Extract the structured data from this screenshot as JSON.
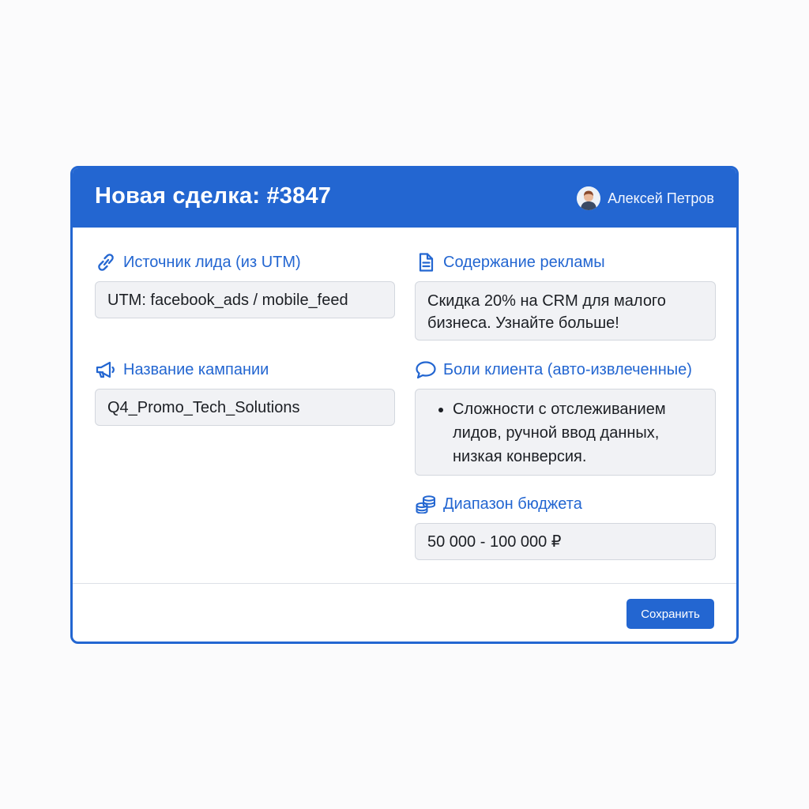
{
  "modal": {
    "title": "Новая сделка: #3847",
    "user_name": "Алексей Петров",
    "save_label": "Сохранить"
  },
  "fields": {
    "lead_source": {
      "label": "Источник лида (из UTM)",
      "value": "UTM: facebook_ads / mobile_feed",
      "icon": "link-icon"
    },
    "campaign_name": {
      "label": "Название кампании",
      "value": "Q4_Promo_Tech_Solutions",
      "icon": "megaphone-icon"
    },
    "ad_content": {
      "label": "Содержание рекламы",
      "value": "Скидка 20% на CRM для малого бизнеса. Узнайте больше!",
      "icon": "document-icon"
    },
    "pain_points": {
      "label": "Боли клиента (авто-извлеченные)",
      "items": [
        "Сложности с отслеживанием лидов, ручной ввод данных, низкая конверсия."
      ],
      "icon": "chat-bubble-icon"
    },
    "budget_range": {
      "label": "Диапазон бюджета",
      "value": "50 000 - 100 000 ₽",
      "icon": "coins-icon"
    }
  },
  "colors": {
    "accent": "#2366d1",
    "field_background": "#f1f2f5",
    "field_border": "#d3d7de"
  }
}
